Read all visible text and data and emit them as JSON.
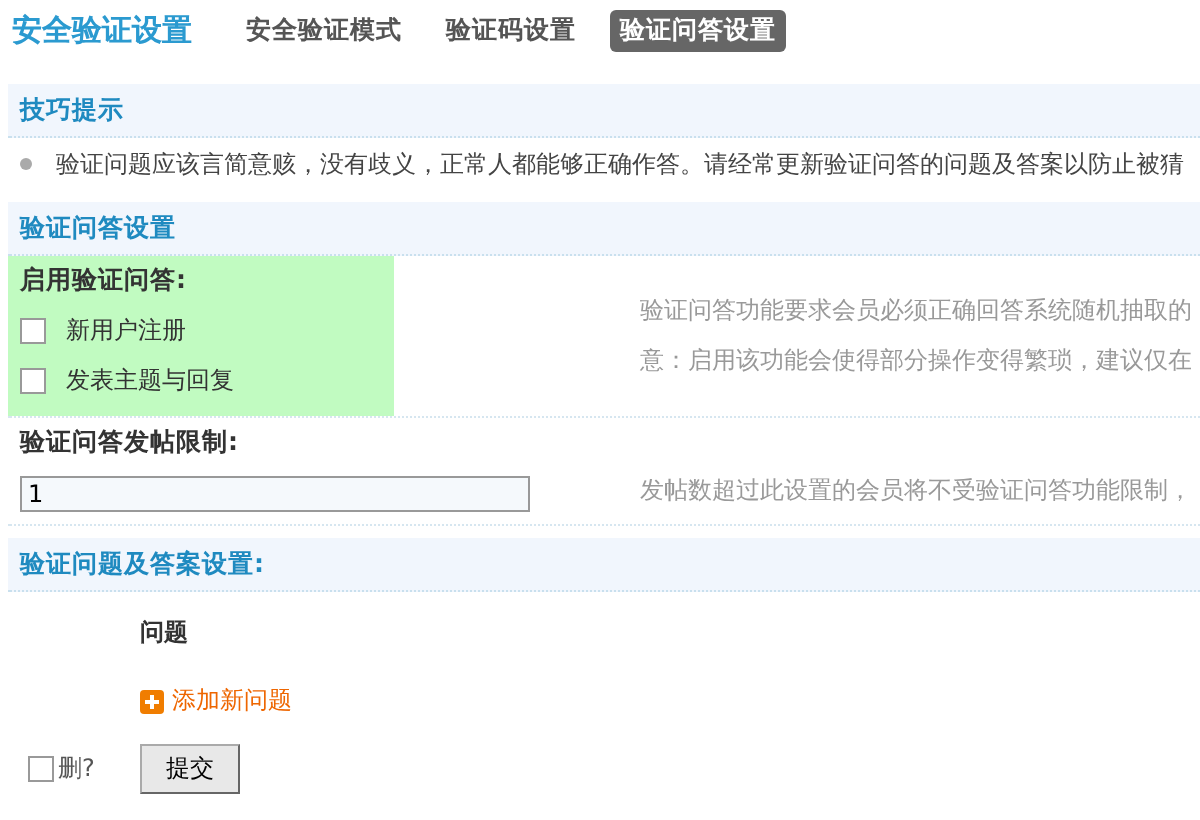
{
  "header": {
    "title": "安全验证设置",
    "tabs": [
      {
        "label": "安全验证模式",
        "selected": false
      },
      {
        "label": "验证码设置",
        "selected": false
      },
      {
        "label": "验证问答设置",
        "selected": true
      }
    ]
  },
  "tips": {
    "title": "技巧提示",
    "items": [
      "验证问题应该言简意赅，没有歧义，正常人都能够正确作答。请经常更新验证问答的问题及答案以防止被猜"
    ]
  },
  "settings": {
    "title": "验证问答设置",
    "enable": {
      "label": "启用验证问答:",
      "highlighted": true,
      "options": [
        {
          "label": "新用户注册",
          "checked": false
        },
        {
          "label": "发表主题与回复",
          "checked": false
        }
      ],
      "description": [
        "验证问答功能要求会员必须正确回答系统随机抽取的",
        "意：启用该功能会使得部分操作变得繁琐，建议仅在"
      ]
    },
    "limit": {
      "label": "验证问答发帖限制:",
      "value": "1",
      "description": [
        "发帖数超过此设置的会员将不受验证问答功能限制，"
      ]
    }
  },
  "questions": {
    "title": "验证问题及答案设置:",
    "column": "问题",
    "add_link": "添加新问题",
    "delete": {
      "label": "删?",
      "checked": false
    },
    "submit": "提交"
  }
}
